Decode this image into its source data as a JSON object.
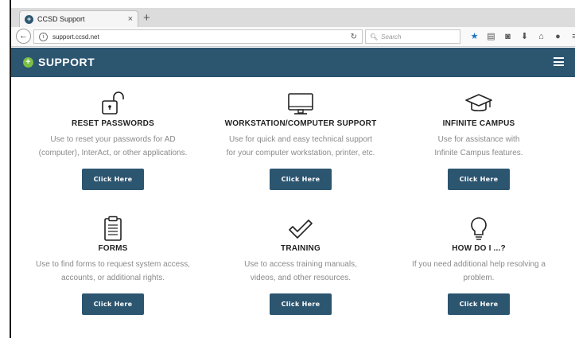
{
  "browser": {
    "tab_title": "CCSD Support",
    "tab_close": "×",
    "new_tab": "+",
    "url": "support.ccsd.net",
    "search_placeholder": "Search",
    "back_glyph": "←",
    "reload_glyph": "↻"
  },
  "site": {
    "logo_text": "SUPPORT",
    "logo_plus": "+",
    "accent": "#2c5570",
    "logo_color": "#79c043"
  },
  "cards": [
    {
      "title": "RESET PASSWORDS",
      "desc_1": "Use to reset your passwords for AD",
      "desc_2": "(computer), InterAct, or other applications.",
      "button": "Click Here",
      "icon": "padlock-icon"
    },
    {
      "title": "WORKSTATION/COMPUTER SUPPORT",
      "desc_1": "Use for quick and easy technical support",
      "desc_2": "for your computer workstation, printer, etc.",
      "button": "Click Here",
      "icon": "monitor-icon"
    },
    {
      "title": "INFINITE CAMPUS",
      "desc_1": "Use for assistance with",
      "desc_2": "Infinite Campus features.",
      "button": "Click Here",
      "icon": "graduation-cap-icon"
    },
    {
      "title": "FORMS",
      "desc_1": "Use to find forms to request system access,",
      "desc_2": "accounts, or additional rights.",
      "button": "Click Here",
      "icon": "clipboard-icon"
    },
    {
      "title": "TRAINING",
      "desc_1": "Use to access training manuals,",
      "desc_2": "videos, and other resources.",
      "button": "Click Here",
      "icon": "checkmark-icon"
    },
    {
      "title": "HOW DO I ...?",
      "desc_1": "If you need additional help resolving a",
      "desc_2": "problem.",
      "button": "Click Here",
      "icon": "lightbulb-icon"
    }
  ]
}
